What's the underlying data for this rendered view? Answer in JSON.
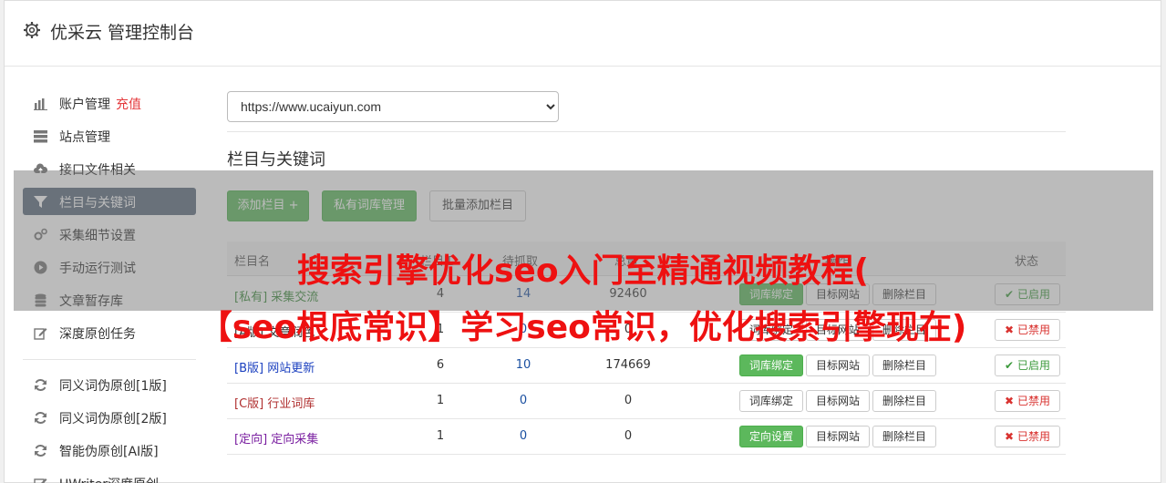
{
  "header": {
    "title": "优采云 管理控制台"
  },
  "sidebar": {
    "items": [
      {
        "label": "账户管理",
        "extra": "充值",
        "icon": "bar-chart-icon"
      },
      {
        "label": "站点管理",
        "icon": "server-icon"
      },
      {
        "label": "接口文件相关",
        "icon": "cloud-upload-icon"
      },
      {
        "label": "栏目与关键词",
        "icon": "filter-icon",
        "active": true
      },
      {
        "label": "采集细节设置",
        "icon": "cogs-icon"
      },
      {
        "label": "手动运行测试",
        "icon": "play-icon"
      },
      {
        "label": "文章暂存库",
        "icon": "database-icon"
      },
      {
        "label": "深度原创任务",
        "icon": "edit-icon"
      },
      {
        "label": "同义词伪原创[1版]",
        "icon": "refresh-icon"
      },
      {
        "label": "同义词伪原创[2版]",
        "icon": "refresh-icon"
      },
      {
        "label": "智能伪原创[AI版]",
        "icon": "refresh-icon"
      },
      {
        "label": "UWriter深度原创",
        "icon": "edit-icon"
      }
    ]
  },
  "site_select": {
    "value": "https://www.ucaiyun.com"
  },
  "section_title": "栏目与关键词",
  "toolbar": {
    "add_column": "添加栏目 +",
    "private_library": "私有词库管理",
    "batch_add": "批量添加栏目"
  },
  "table": {
    "headers": {
      "name": "栏目名",
      "id": "栏目ID",
      "pending": "待抓取",
      "total": "总量",
      "actions": "操作",
      "status": "状态"
    },
    "rows": [
      {
        "tag": "[私有]",
        "name": "采集交流",
        "color": "#3a8a3a",
        "id": "4",
        "pending": "14",
        "total": "92460",
        "bind": "词库绑定",
        "bind_green": true,
        "target": "目标网站",
        "delete": "删除栏目",
        "status": "已启用",
        "on": true
      },
      {
        "tag": "[A版]",
        "name": "文章润色",
        "color": "#333333",
        "id": "1",
        "pending": "0",
        "total": "0",
        "bind": "词库绑定",
        "bind_green": false,
        "target": "目标网站",
        "delete": "删除栏目",
        "status": "已禁用",
        "on": false
      },
      {
        "tag": "[B版]",
        "name": "网站更新",
        "color": "#1a3fbf",
        "id": "6",
        "pending": "10",
        "total": "174669",
        "bind": "词库绑定",
        "bind_green": true,
        "target": "目标网站",
        "delete": "删除栏目",
        "status": "已启用",
        "on": true
      },
      {
        "tag": "[C版]",
        "name": "行业词库",
        "color": "#b03030",
        "id": "1",
        "pending": "0",
        "total": "0",
        "bind": "词库绑定",
        "bind_green": false,
        "target": "目标网站",
        "delete": "删除栏目",
        "status": "已禁用",
        "on": false
      },
      {
        "tag": "[定向]",
        "name": "定向采集",
        "color": "#7a1fa0",
        "id": "1",
        "pending": "0",
        "total": "0",
        "bind": "定向设置",
        "bind_green": true,
        "target": "目标网站",
        "delete": "删除栏目",
        "status": "已禁用",
        "on": false
      }
    ]
  },
  "watermark": {
    "line1": "搜索引擎优化seo入门至精通视频教程(",
    "line2": "【seo根底常识】学习seo常识，优化搜索引擎现在)"
  }
}
